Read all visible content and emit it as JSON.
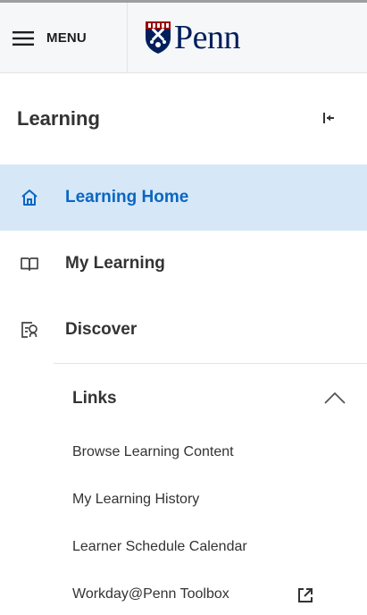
{
  "header": {
    "menu_label": "MENU",
    "logo_text": "Penn"
  },
  "section": {
    "title": "Learning"
  },
  "nav": {
    "items": [
      {
        "label": "Learning Home",
        "icon": "home-icon",
        "active": true
      },
      {
        "label": "My Learning",
        "icon": "book-icon",
        "active": false
      },
      {
        "label": "Discover",
        "icon": "discover-icon",
        "active": false
      }
    ]
  },
  "links": {
    "heading": "Links",
    "expanded": true,
    "items": [
      {
        "label": "Browse Learning Content"
      },
      {
        "label": "My Learning History"
      },
      {
        "label": "Learner Schedule Calendar"
      },
      {
        "label": "Workday@Penn Toolbox",
        "external": true
      }
    ]
  },
  "colors": {
    "active_bg": "#d6e8f8",
    "active_text": "#0b66c2",
    "penn_navy": "#011f5b",
    "penn_red": "#990000"
  }
}
